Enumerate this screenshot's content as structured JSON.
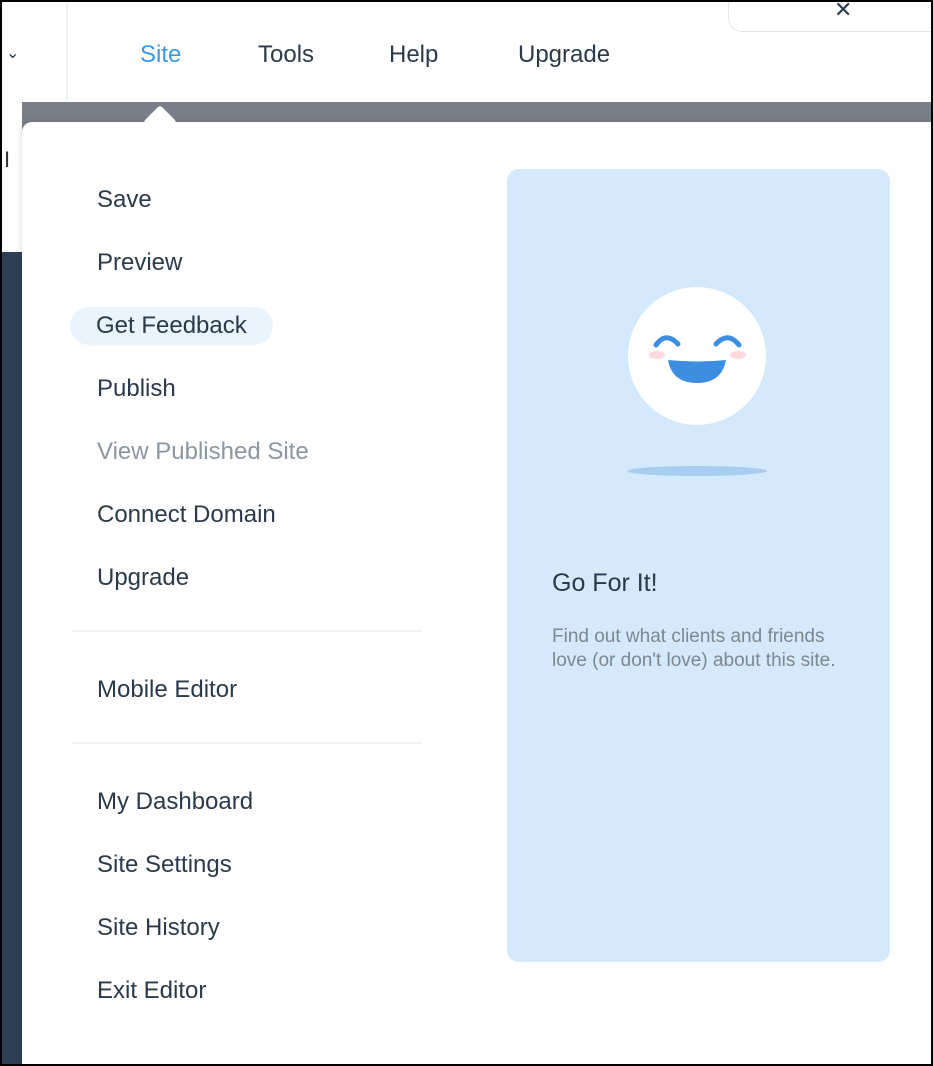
{
  "menubar": {
    "items": [
      {
        "label": "Site",
        "active": true
      },
      {
        "label": "Tools",
        "active": false
      },
      {
        "label": "Help",
        "active": false
      },
      {
        "label": "Upgrade",
        "active": false
      }
    ],
    "left_icon": "chevron-down-icon",
    "close_icon": "close-icon"
  },
  "site_menu": {
    "group1": [
      {
        "label": "Save"
      },
      {
        "label": "Preview"
      },
      {
        "label": "Get Feedback",
        "highlighted": true
      },
      {
        "label": "Publish"
      },
      {
        "label": "View Published Site",
        "disabled": true
      },
      {
        "label": "Connect Domain"
      },
      {
        "label": "Upgrade"
      }
    ],
    "group2": [
      {
        "label": "Mobile Editor"
      }
    ],
    "group3": [
      {
        "label": "My Dashboard"
      },
      {
        "label": "Site Settings"
      },
      {
        "label": "Site History"
      },
      {
        "label": "Exit Editor"
      }
    ]
  },
  "feature_card": {
    "illustration": "smiley-face-icon",
    "title": "Go For It!",
    "description": "Find out what clients and friends love (or don't love) about this site."
  },
  "colors": {
    "accent": "#3899ec",
    "text": "#2b3a4a",
    "muted": "#8c96a0",
    "card_bg": "#d4e9fb",
    "highlight_bg": "#eaf4fd"
  }
}
